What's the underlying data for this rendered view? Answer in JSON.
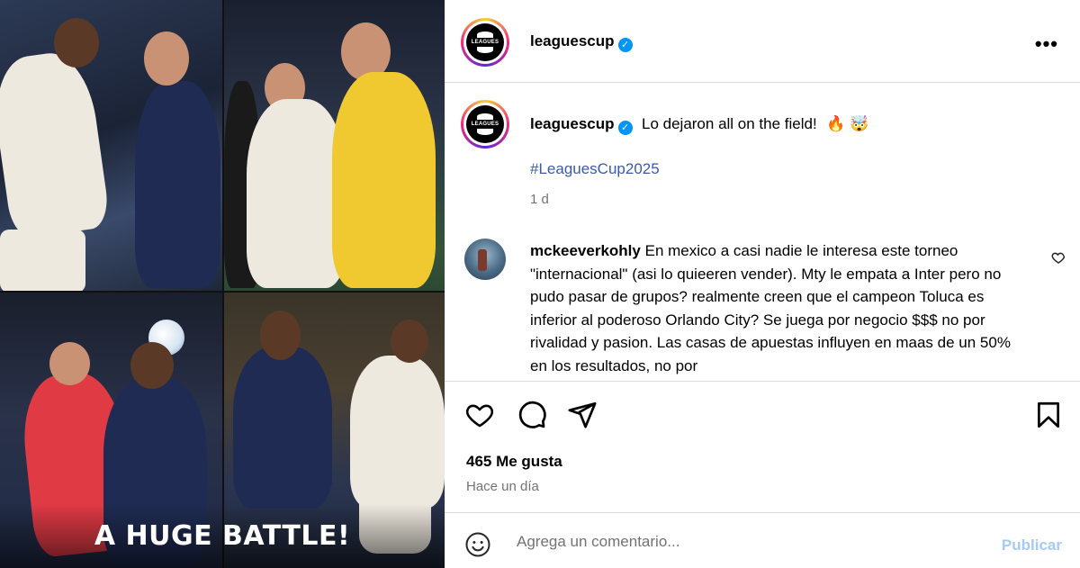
{
  "post": {
    "media": {
      "overlay_text": "A HUGE BATTLE!",
      "logo_text": "LEAGUES CUP"
    },
    "header": {
      "username": "leaguescup",
      "verified_mark": "✓",
      "more_label": "•••"
    },
    "caption": {
      "username": "leaguescup",
      "text": "Lo dejaron all on the field!",
      "emojis": "🔥 🤯",
      "hashtag": "#LeaguesCup2025",
      "time": "1 d"
    },
    "comment": {
      "username": "mckeeverkohly",
      "text": "En mexico a casi nadie le interesa este torneo \"internacional\" (asi lo quieeren vender). Mty le empata a Inter pero no pudo pasar de grupos? realmente creen que el campeon Toluca es inferior al poderoso Orlando City? Se juega por negocio $$$ no por rivalidad y pasion. Las casas de apuestas influyen en maas de un 50% en los resultados, no por"
    },
    "likes": "465 Me gusta",
    "posted_ago": "Hace un día",
    "compose": {
      "placeholder": "Agrega un comentario...",
      "publish_label": "Publicar"
    },
    "icons": [
      "heart-icon",
      "comment-icon",
      "share-icon",
      "bookmark-icon",
      "emoji-icon",
      "more-icon",
      "verified-icon"
    ]
  }
}
